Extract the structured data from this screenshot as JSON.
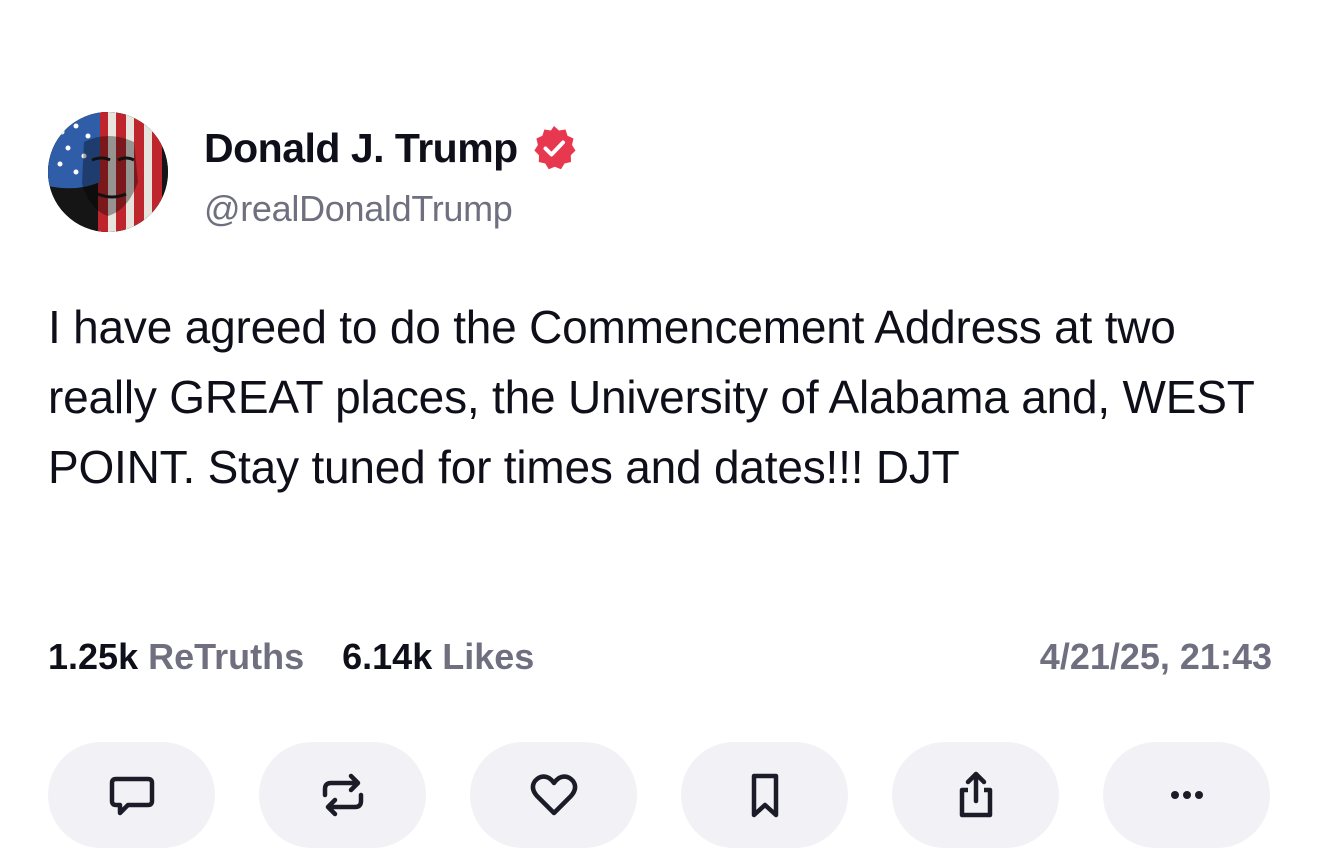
{
  "author": {
    "display_name": "Donald J. Trump",
    "handle": "@realDonaldTrump",
    "verified": true,
    "verified_color": "#e8384f",
    "avatar_icon": "avatar-flag-portrait"
  },
  "post": {
    "text": "I have agreed to do the Commencement Address at two really GREAT places, the University of Alabama and, WEST POINT. Stay tuned for times and dates!!! DJT"
  },
  "stats": {
    "retruths_count": "1.25k",
    "retruths_label": "ReTruths",
    "likes_count": "6.14k",
    "likes_label": "Likes",
    "timestamp": "4/21/25, 21:43"
  },
  "actions": [
    {
      "icon": "reply-icon"
    },
    {
      "icon": "retruth-icon"
    },
    {
      "icon": "like-icon"
    },
    {
      "icon": "bookmark-icon"
    },
    {
      "icon": "share-icon"
    },
    {
      "icon": "more-icon"
    }
  ],
  "colors": {
    "text": "#0f0f1a",
    "muted": "#6f6f80",
    "button_bg": "#f2f2f6"
  }
}
